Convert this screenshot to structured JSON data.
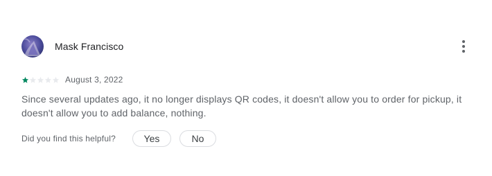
{
  "review": {
    "author": "Mask Francisco",
    "rating": 1,
    "max_rating": 5,
    "date": "August 3, 2022",
    "text": "Since several updates ago, it no longer displays QR codes, it doesn't allow you to order for pickup, it doesn't allow you to add balance, nothing.",
    "avatar_icon": "user-avatar-icon",
    "more_icon": "more-vert-icon"
  },
  "helpful": {
    "question": "Did you find this helpful?",
    "yes_label": "Yes",
    "no_label": "No"
  },
  "colors": {
    "star_filled": "#01875f",
    "star_empty": "#e8eaed",
    "chip_border": "#dadce0"
  }
}
